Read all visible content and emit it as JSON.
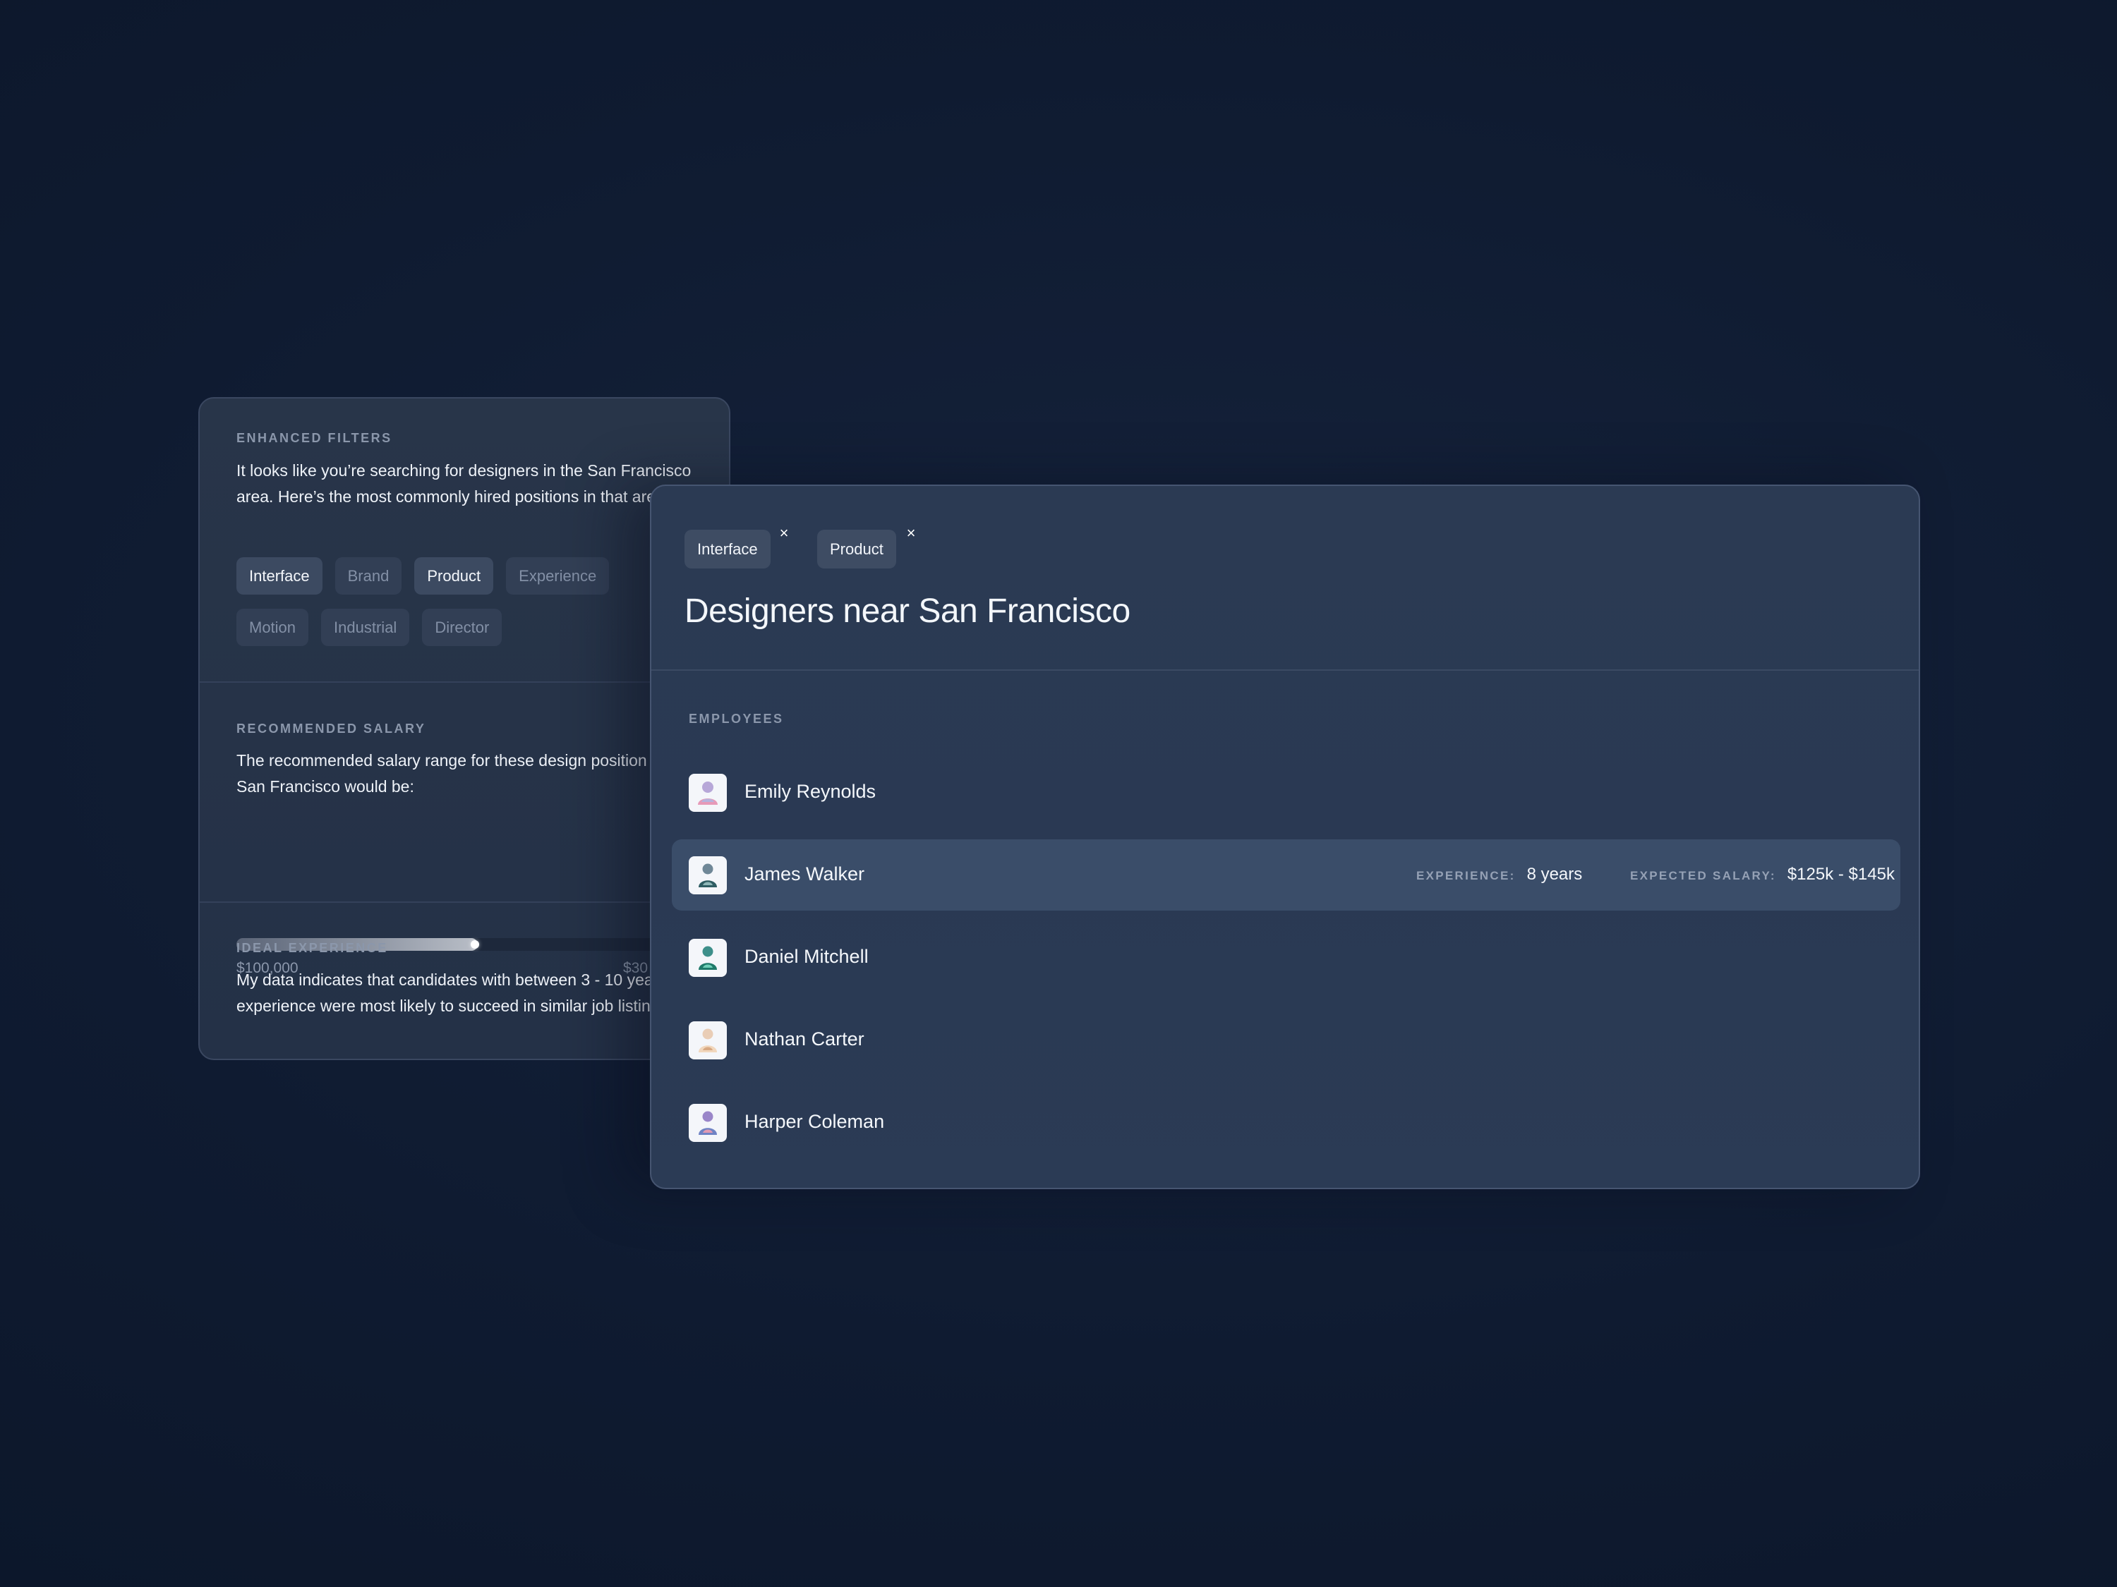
{
  "filters_panel": {
    "enhanced_filters": {
      "label": "ENHANCED FILTERS",
      "text": "It looks like you’re searching for designers in the San Francisco\narea. Here’s the most commonly hired positions in that are",
      "chips": [
        {
          "label": "Interface",
          "active": true
        },
        {
          "label": "Brand",
          "active": false
        },
        {
          "label": "Product",
          "active": true
        },
        {
          "label": "Experience",
          "active": false
        },
        {
          "label": "Motion",
          "active": false
        },
        {
          "label": "Industrial",
          "active": false
        },
        {
          "label": "Director",
          "active": false
        }
      ]
    },
    "recommended_salary": {
      "label": "RECOMMENDED SALARY",
      "text": "The recommended salary range for these design position\nSan Francisco would be:",
      "slider": {
        "min_label": "$100,000",
        "max_label": "$30",
        "fill_fraction": 0.45
      }
    },
    "ideal_experience": {
      "label": "IDEAL EXPERIENCE",
      "text": "My data indicates that candidates with between 3 - 10 yea\nexperience were most likely to succeed in similar job listin"
    }
  },
  "results_panel": {
    "tags": [
      {
        "label": "Interface",
        "close_icon": "close-icon"
      },
      {
        "label": "Product",
        "close_icon": "close-icon"
      }
    ],
    "close_symbol": "×",
    "title": "Designers near San Francisco",
    "employees_label": "EMPLOYEES",
    "employees": [
      {
        "name": "Emily Reynolds",
        "avatar": "avatar-pink"
      },
      {
        "name": "James Walker",
        "avatar": "avatar-teal",
        "highlighted": true,
        "experience_label": "EXPERIENCE:",
        "experience_value": "8 years",
        "salary_label": "EXPECTED SALARY:",
        "salary_value": "$125k - $145k"
      },
      {
        "name": "Daniel Mitchell",
        "avatar": "avatar-green"
      },
      {
        "name": "Nathan Carter",
        "avatar": "avatar-peach"
      },
      {
        "name": "Harper Coleman",
        "avatar": "avatar-purple"
      }
    ]
  },
  "colors": {
    "background": "#0f1b31",
    "panel": "#2a3953",
    "highlight_row": "#3a4d69",
    "chip_active": "#3c4a61",
    "chip_inactive": "#323f55",
    "muted_text": "#8b97ab"
  }
}
